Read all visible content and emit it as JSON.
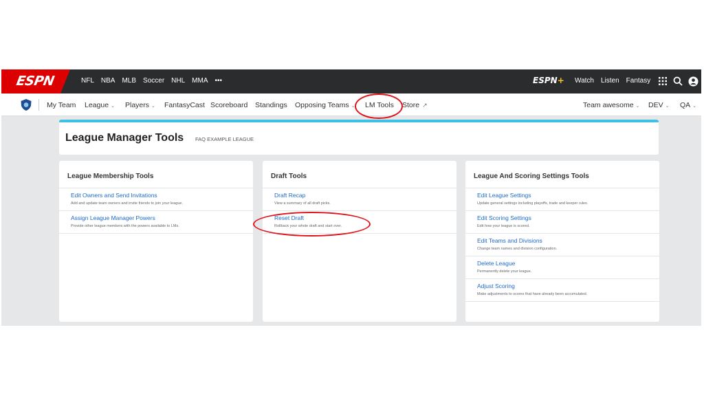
{
  "topbar": {
    "logo": "ESPN",
    "sports": [
      "NFL",
      "NBA",
      "MLB",
      "Soccer",
      "NHL",
      "MMA",
      "•••"
    ],
    "espn_plus": "ESPN",
    "right_links": [
      "Watch",
      "Listen",
      "Fantasy"
    ]
  },
  "subnav": {
    "items": [
      "My Team",
      "League",
      "Players",
      "FantasyCast",
      "Scoreboard",
      "Standings",
      "Opposing Teams",
      "LM Tools",
      "Store"
    ],
    "right": [
      "Team awesome",
      "DEV",
      "QA"
    ]
  },
  "header": {
    "title": "League Manager Tools",
    "league": "FAQ EXAMPLE LEAGUE"
  },
  "cards": [
    {
      "title": "League Membership Tools",
      "rows": [
        {
          "link": "Edit Owners and Send Invitations",
          "desc": "Add and update team owners and invite friends to join your league."
        },
        {
          "link": "Assign League Manager Powers",
          "desc": "Provide other league members with the powers available to LMs."
        }
      ]
    },
    {
      "title": "Draft Tools",
      "rows": [
        {
          "link": "Draft Recap",
          "desc": "View a summary of all draft picks."
        },
        {
          "link": "Reset Draft",
          "desc": "Rollback your whole draft and start over."
        }
      ]
    },
    {
      "title": "League And Scoring Settings Tools",
      "rows": [
        {
          "link": "Edit League Settings",
          "desc": "Update general settings including playoffs, trade and keeper rules."
        },
        {
          "link": "Edit Scoring Settings",
          "desc": "Edit how your league is scored."
        },
        {
          "link": "Edit Teams and Divisions",
          "desc": "Change team names and division configuration."
        },
        {
          "link": "Delete League",
          "desc": "Permanently delete your league."
        },
        {
          "link": "Adjust Scoring",
          "desc": "Make adjustments to scores that have already been accumulated."
        }
      ]
    }
  ],
  "colors": {
    "topbar": "#2b2c2d",
    "brand_red": "#dd0000",
    "accent_blue": "#3fc1e6",
    "link": "#1d69c9",
    "annotation_red": "#e0131b"
  },
  "icons": [
    "shield-icon",
    "apps-grid-icon",
    "search-icon",
    "user-icon",
    "chevron-down-icon",
    "external-link-icon"
  ]
}
